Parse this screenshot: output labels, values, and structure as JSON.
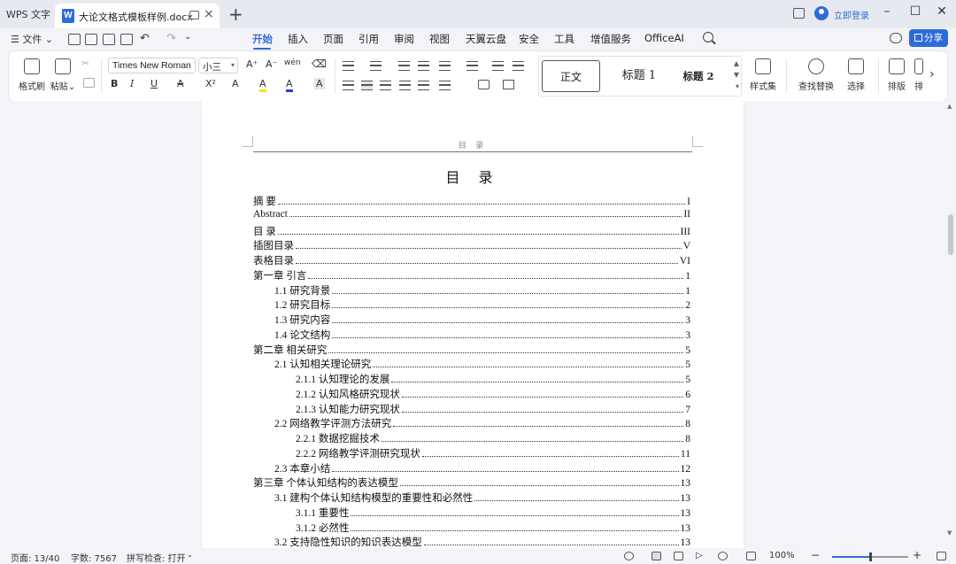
{
  "titlebar": {
    "app_tab": "WPS 文字",
    "doc_icon_letter": "W",
    "doc_tab": "大论文格式模板样例.docx",
    "login": "立即登录"
  },
  "menubar": {
    "file_label": "文件",
    "tabs": [
      "开始",
      "插入",
      "页面",
      "引用",
      "审阅",
      "视图",
      "天翼云盘",
      "安全",
      "工具",
      "增值服务",
      "OfficeAI"
    ],
    "active_tab": "开始",
    "share_label": "分享"
  },
  "ribbon": {
    "format_painter": "格式刷",
    "paste": "粘贴",
    "font_name": "Times New Roman",
    "font_size": "小三",
    "bold": "B",
    "italic": "I",
    "underline": "U",
    "strike": "A",
    "superscript": "X²",
    "effects": "A",
    "highlight": "A",
    "font_color": "A",
    "char_shading": "A",
    "grow_font": "A⁺",
    "shrink_font": "A⁻",
    "pinyin": "wén",
    "styles": [
      "正文",
      "标题 1",
      "标题 2"
    ],
    "style_set": "样式集",
    "find_replace": "查找替换",
    "select": "选择",
    "layout": "排版",
    "more": "排"
  },
  "document": {
    "header_text": "目 录",
    "title": "目 录",
    "toc": [
      {
        "text": "摘  要",
        "page": "I",
        "level": 0
      },
      {
        "text": "Abstract",
        "page": "II",
        "level": 0
      },
      {
        "text": "目  录",
        "page": "III",
        "level": 0
      },
      {
        "text": "插图目录",
        "page": "V",
        "level": 0
      },
      {
        "text": "表格目录",
        "page": "VI",
        "level": 0
      },
      {
        "text": "第一章  引言",
        "page": "1",
        "level": 0
      },
      {
        "text": "1.1  研究背景",
        "page": "1",
        "level": 1
      },
      {
        "text": "1.2  研究目标",
        "page": "2",
        "level": 1
      },
      {
        "text": "1.3  研究内容",
        "page": "3",
        "level": 1
      },
      {
        "text": "1.4  论文结构",
        "page": "3",
        "level": 1
      },
      {
        "text": "第二章  相关研究",
        "page": "5",
        "level": 0
      },
      {
        "text": "2.1  认知相关理论研究",
        "page": "5",
        "level": 1
      },
      {
        "text": "2.1.1  认知理论的发展",
        "page": "5",
        "level": 2
      },
      {
        "text": "2.1.2  认知风格研究现状",
        "page": "6",
        "level": 2
      },
      {
        "text": "2.1.3  认知能力研究现状",
        "page": "7",
        "level": 2
      },
      {
        "text": "2.2  网络教学评测方法研究",
        "page": "8",
        "level": 1
      },
      {
        "text": "2.2.1  数据挖掘技术",
        "page": "8",
        "level": 2
      },
      {
        "text": "2.2.2  网络教学评测研究现状",
        "page": "11",
        "level": 2
      },
      {
        "text": "2.3  本章小结",
        "page": "12",
        "level": 1
      },
      {
        "text": "第三章  个体认知结构的表达模型",
        "page": "13",
        "level": 0
      },
      {
        "text": "3.1  建构个体认知结构模型的重要性和必然性",
        "page": "13",
        "level": 1
      },
      {
        "text": "3.1.1  重要性",
        "page": "13",
        "level": 2
      },
      {
        "text": "3.1.2  必然性",
        "page": "13",
        "level": 2
      },
      {
        "text": "3.2  支持隐性知识的知识表达模型",
        "page": "13",
        "level": 1
      }
    ]
  },
  "statusbar": {
    "page": "页面: 13/40",
    "words": "字数: 7567",
    "spell": "拼写检查: 打开",
    "zoom": "100%",
    "zoom_fraction": 0.5
  },
  "colors": {
    "accent": "#2f6bd8",
    "chrome": "#f3f4f7"
  }
}
